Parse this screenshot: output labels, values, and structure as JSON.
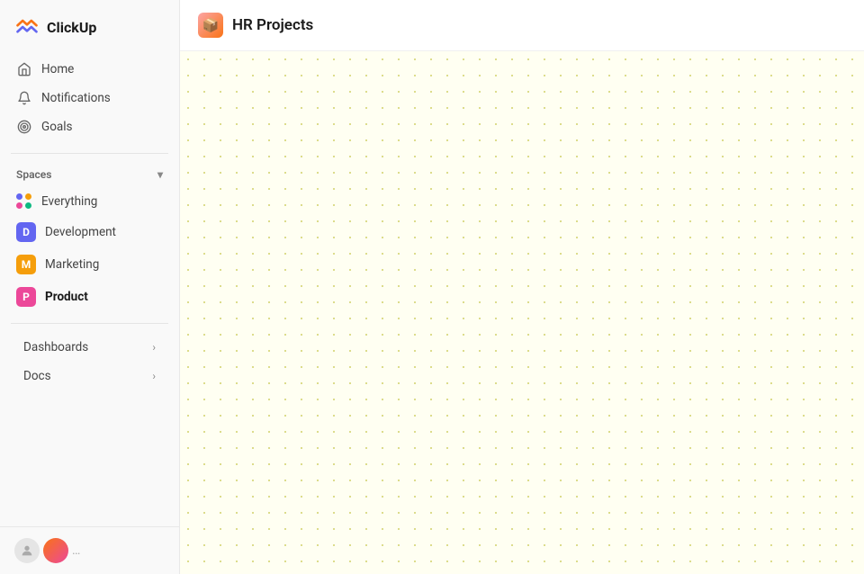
{
  "app": {
    "name": "ClickUp"
  },
  "sidebar": {
    "logo_text": "ClickUp",
    "nav_items": [
      {
        "id": "home",
        "label": "Home",
        "icon": "home"
      },
      {
        "id": "notifications",
        "label": "Notifications",
        "icon": "bell"
      },
      {
        "id": "goals",
        "label": "Goals",
        "icon": "target"
      }
    ],
    "spaces_label": "Spaces",
    "spaces": [
      {
        "id": "everything",
        "label": "Everything",
        "type": "grid"
      },
      {
        "id": "development",
        "label": "Development",
        "badge": "D",
        "color": "#6366f1"
      },
      {
        "id": "marketing",
        "label": "Marketing",
        "badge": "M",
        "color": "#f59e0b"
      },
      {
        "id": "product",
        "label": "Product",
        "badge": "P",
        "color": "#ec4899",
        "active": true
      }
    ],
    "dashboards_label": "Dashboards",
    "docs_label": "Docs"
  },
  "header": {
    "project_icon": "📦",
    "project_title": "HR Projects"
  },
  "canvas": {
    "background": "#fffff0"
  }
}
